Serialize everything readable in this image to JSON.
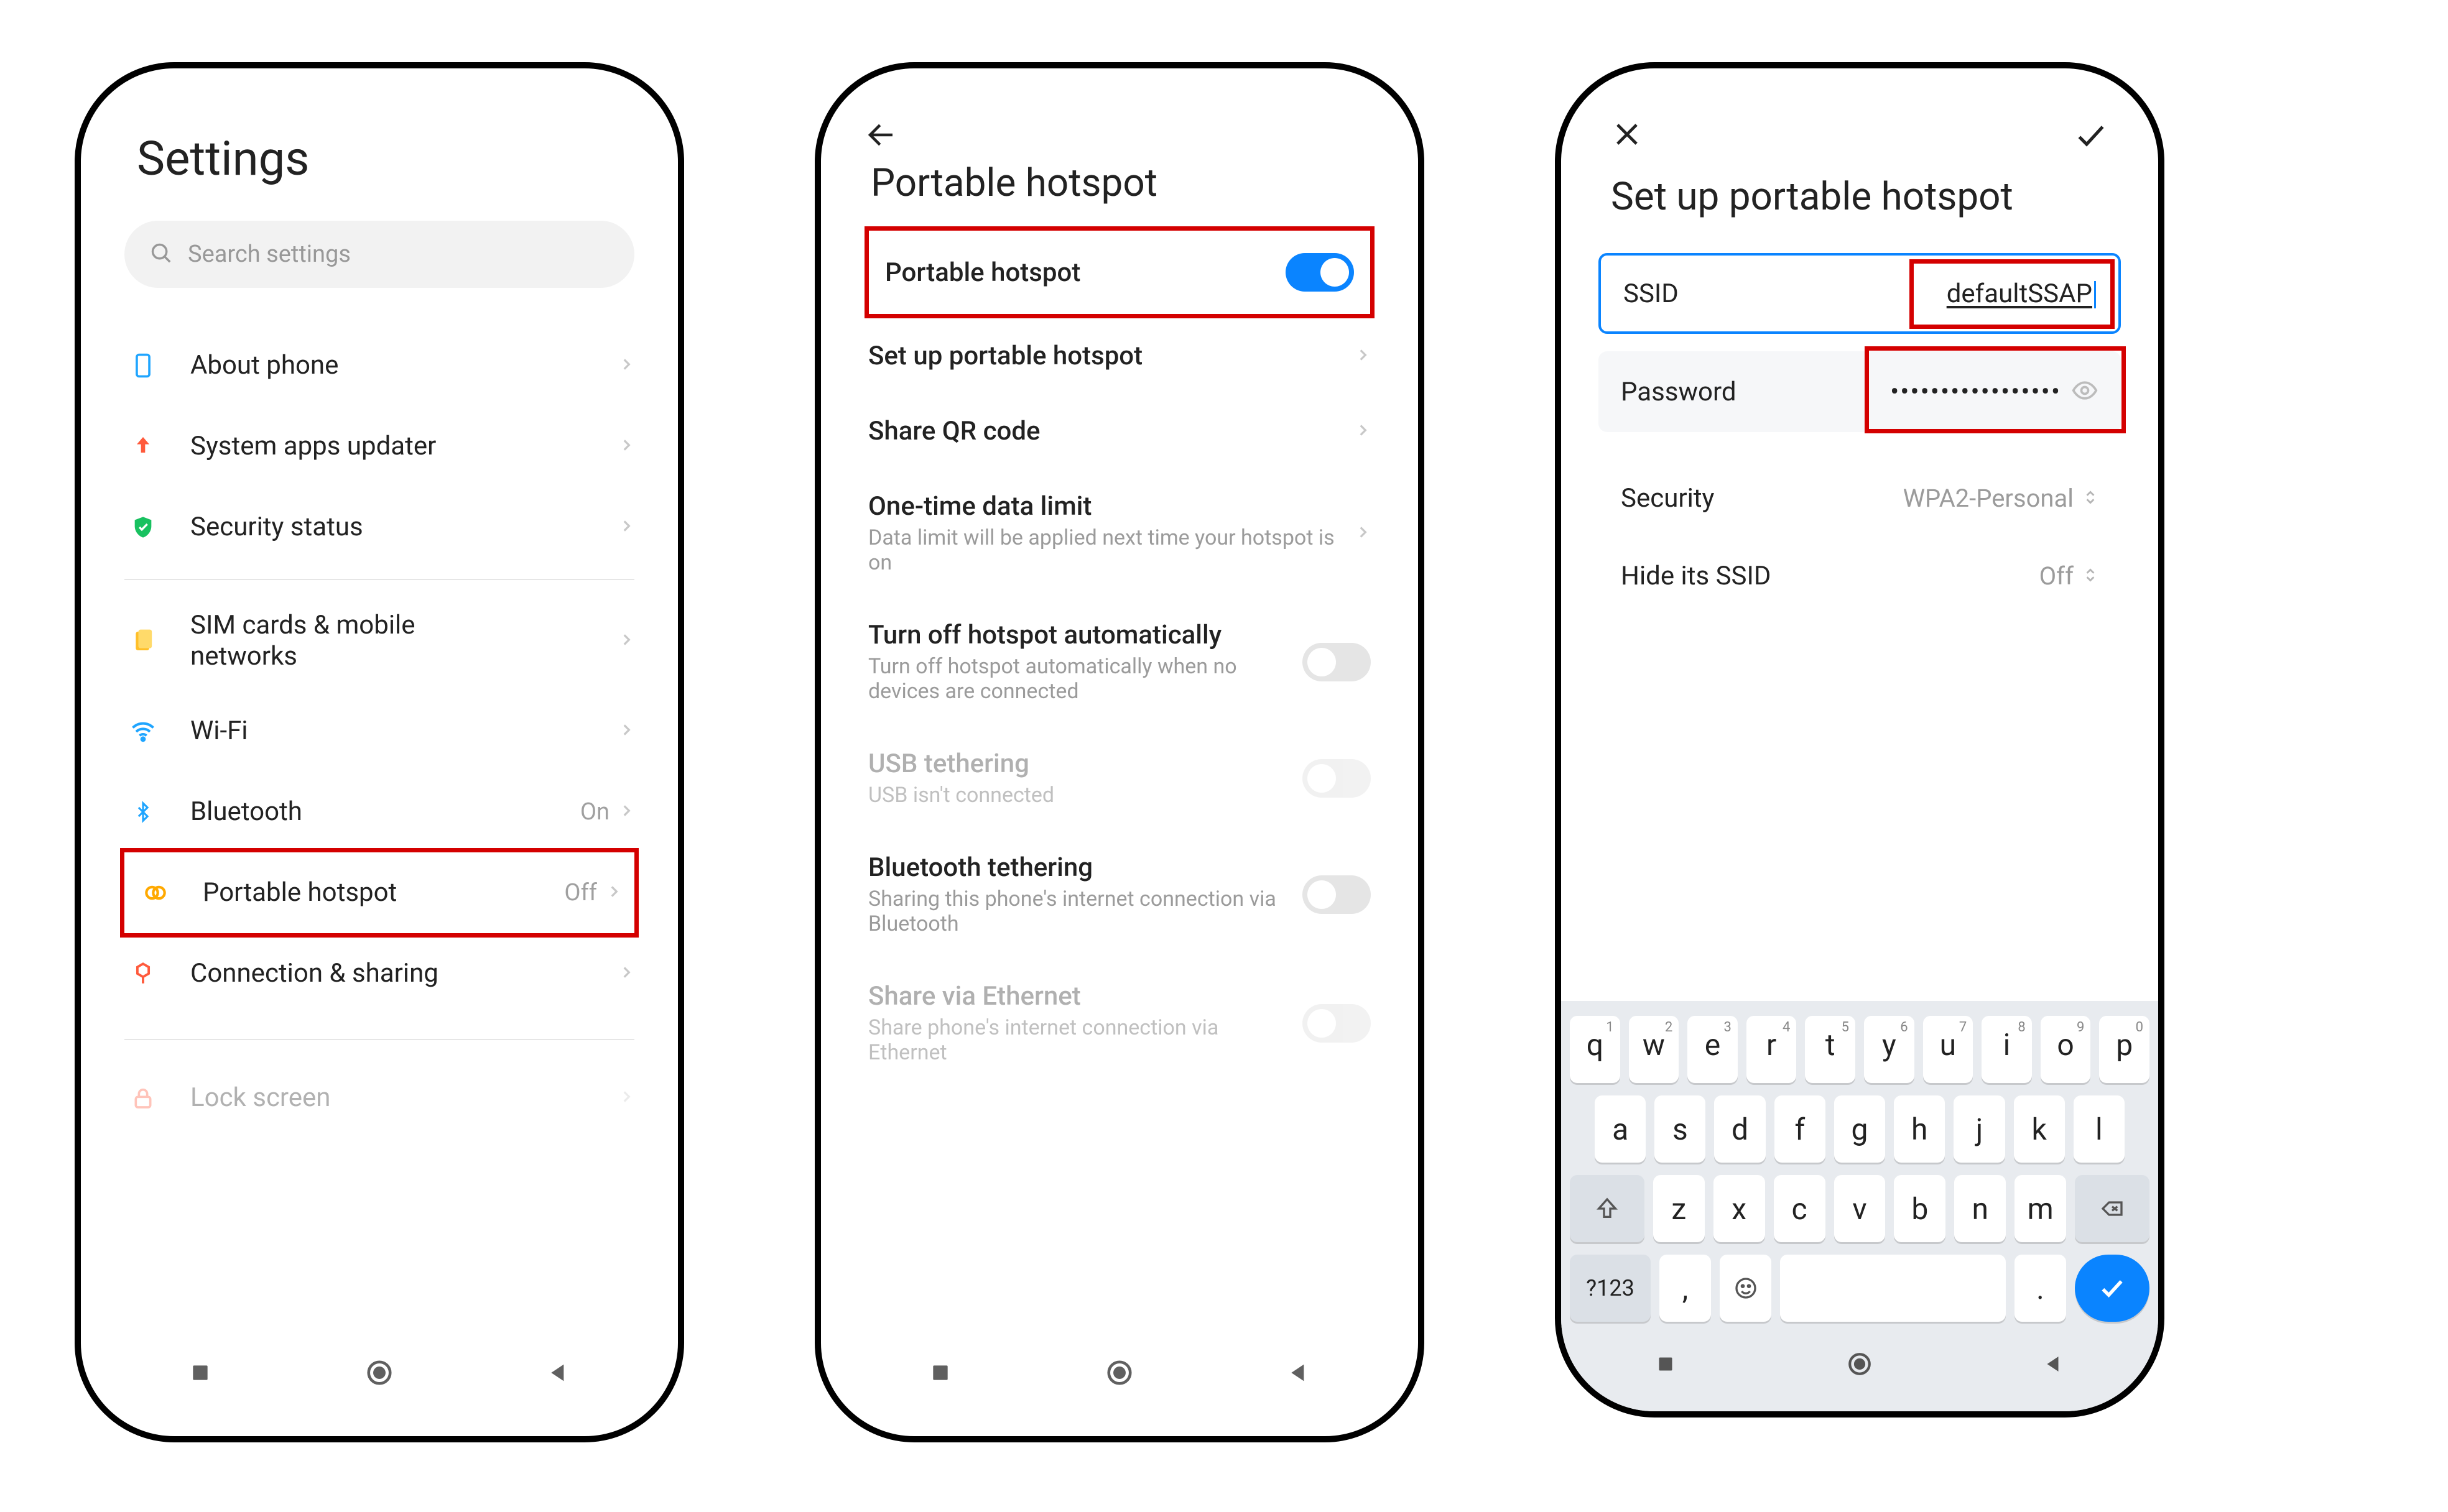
{
  "screen1": {
    "title": "Settings",
    "search_placeholder": "Search settings",
    "items": [
      {
        "label": "About phone"
      },
      {
        "label": "System apps updater"
      },
      {
        "label": "Security status"
      }
    ],
    "items2": [
      {
        "label_line1": "SIM cards & mobile",
        "label_line2": "networks"
      },
      {
        "label": "Wi-Fi"
      },
      {
        "label": "Bluetooth",
        "state": "On"
      },
      {
        "label": "Portable hotspot",
        "state": "Off",
        "highlighted": true
      },
      {
        "label": "Connection & sharing"
      }
    ],
    "peek_item": "Lock screen"
  },
  "screen2": {
    "title": "Portable hotspot",
    "rows": {
      "hotspot": {
        "label": "Portable hotspot",
        "toggle": "on",
        "highlighted": true
      },
      "setup": {
        "label": "Set up portable hotspot"
      },
      "qr": {
        "label": "Share QR code"
      },
      "onetime": {
        "label": "One-time data limit",
        "sub": "Data limit will be applied next time your hotspot is on"
      },
      "auto": {
        "label": "Turn off hotspot automatically",
        "sub": "Turn off hotspot automatically when no devices are connected",
        "toggle": "off"
      },
      "usb": {
        "label": "USB tethering",
        "sub": "USB isn't connected",
        "toggle": "off",
        "disabled": true
      },
      "bt": {
        "label": "Bluetooth tethering",
        "sub": "Sharing this phone's internet connection via Bluetooth",
        "toggle": "off"
      },
      "eth": {
        "label": "Share via Ethernet",
        "sub": "Share phone's internet connection via Ethernet",
        "toggle": "off",
        "disabled": true
      }
    }
  },
  "screen3": {
    "title": "Set up portable hotspot",
    "ssid_label": "SSID",
    "ssid_value": "defaultSSAP",
    "password_label": "Password",
    "password_value": "•••••••••••••••••",
    "security_label": "Security",
    "security_value": "WPA2-Personal",
    "hide_label": "Hide its SSID",
    "hide_value": "Off",
    "keyboard": {
      "row1": [
        "q",
        "w",
        "e",
        "r",
        "t",
        "y",
        "u",
        "i",
        "o",
        "p"
      ],
      "row1sup": [
        "1",
        "2",
        "3",
        "4",
        "5",
        "6",
        "7",
        "8",
        "9",
        "0"
      ],
      "row2": [
        "a",
        "s",
        "d",
        "f",
        "g",
        "h",
        "j",
        "k",
        "l"
      ],
      "row3": [
        "z",
        "x",
        "c",
        "v",
        "b",
        "n",
        "m"
      ],
      "k123": "?123",
      "comma": ",",
      "dot": "."
    }
  }
}
